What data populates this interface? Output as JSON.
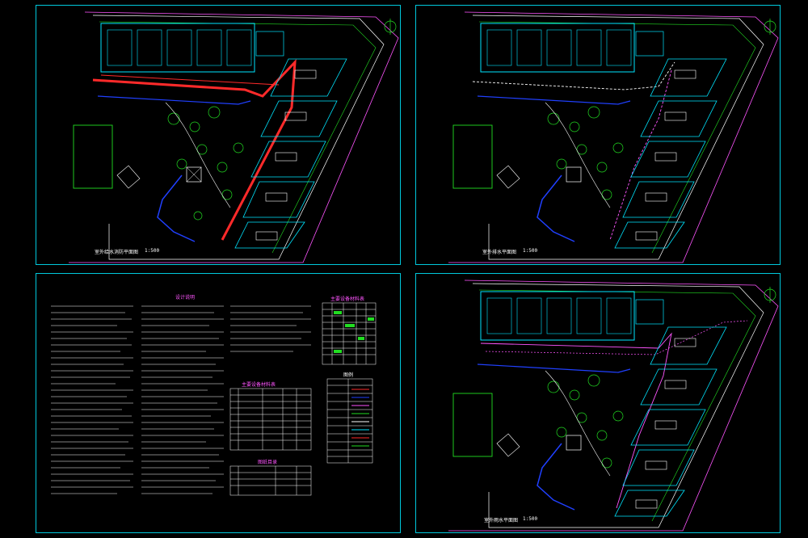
{
  "sheets": [
    {
      "id": "plan-top-left",
      "title": "室外给水消防平面图",
      "scale": "1:500"
    },
    {
      "id": "plan-top-right",
      "title": "室外排水平面图",
      "scale": "1:500"
    },
    {
      "id": "notes-sheet",
      "title": "设计说明"
    },
    {
      "id": "plan-bottom-right",
      "title": "室外雨水平面图",
      "scale": "1:500"
    }
  ],
  "notes": {
    "design_notes_title": "设计说明",
    "material_table_title": "主要设备材料表",
    "legend_title": "图例",
    "drawing_list_title": "图纸目录",
    "table_top_right_title": "主要设备材料表"
  },
  "colors": {
    "frame": "#00c8dc",
    "building": "#00e5ff",
    "road": "#ffffff",
    "water_supply": "#ff2a2a",
    "drain": "#2040ff",
    "green": "#22dd22",
    "boundary": "#ff55ff",
    "tree": "#00ff66"
  }
}
